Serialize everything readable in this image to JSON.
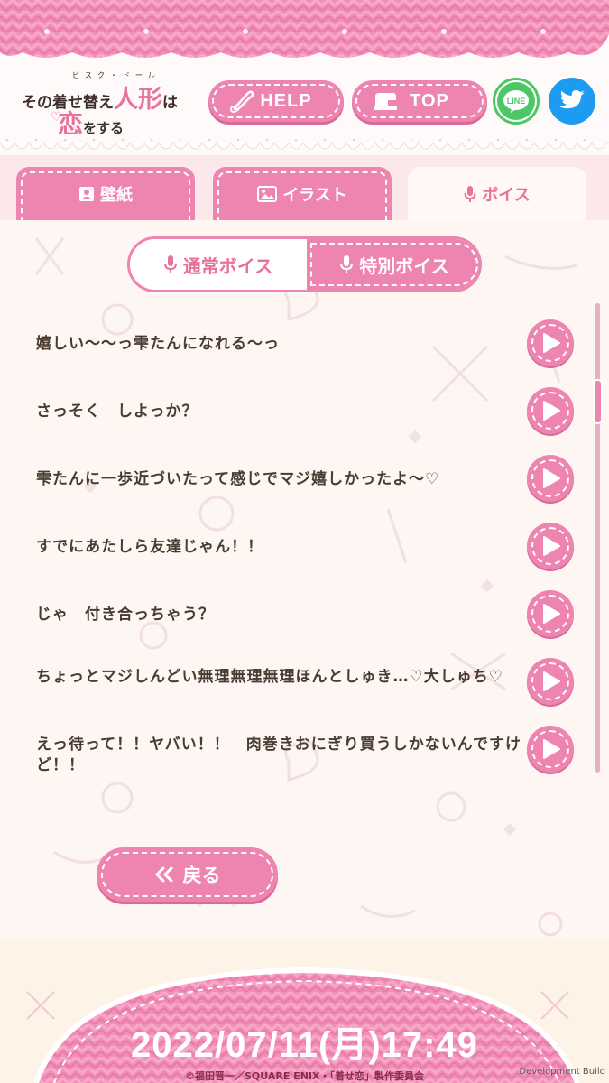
{
  "logo": {
    "ruby": "ビスク・ドール",
    "line1_a": "その着せ替え",
    "line1_b": "人形",
    "line1_c": "は",
    "line2_a": "恋",
    "line2_b": "をする"
  },
  "header": {
    "help_label": "HELP",
    "top_label": "TOP",
    "line_label": "LINE"
  },
  "tabs": [
    {
      "label": "壁紙",
      "icon": "person-portrait-icon",
      "active": false
    },
    {
      "label": "イラスト",
      "icon": "image-icon",
      "active": false
    },
    {
      "label": "ボイス",
      "icon": "microphone-icon",
      "active": true
    }
  ],
  "segment": {
    "normal_label": "通常ボイス",
    "special_label": "特別ボイス",
    "selected": "special"
  },
  "voices": [
    {
      "text": "嬉しい〜〜っ雫たんになれる〜っ"
    },
    {
      "text": "さっそく　しよっか？"
    },
    {
      "text": "雫たんに一歩近づいたって感じでマジ嬉しかったよ〜♡"
    },
    {
      "text": "すでにあたしら友達じゃん！！"
    },
    {
      "text": "じゃ　付き合っちゃう？"
    },
    {
      "text": "ちょっとマジしんどい無理無理無理ほんとしゅき…♡大しゅち♡"
    },
    {
      "text": "えっ待って！！ヤバい！！　肉巻きおにぎり買うしかないんですけど！！"
    }
  ],
  "back_label": "戻る",
  "footer": {
    "datetime": "2022/07/11(月)17:49",
    "copyright": "©福田晋一／SQUARE ENIX・「着せ恋」製作委員会",
    "dev_build": "Development Build"
  },
  "colors": {
    "pink": "#ee84b0",
    "pink_dark": "#d76a98",
    "text": "#4a3b30",
    "line_green": "#4cc764",
    "twitter_blue": "#1d9bf0"
  }
}
